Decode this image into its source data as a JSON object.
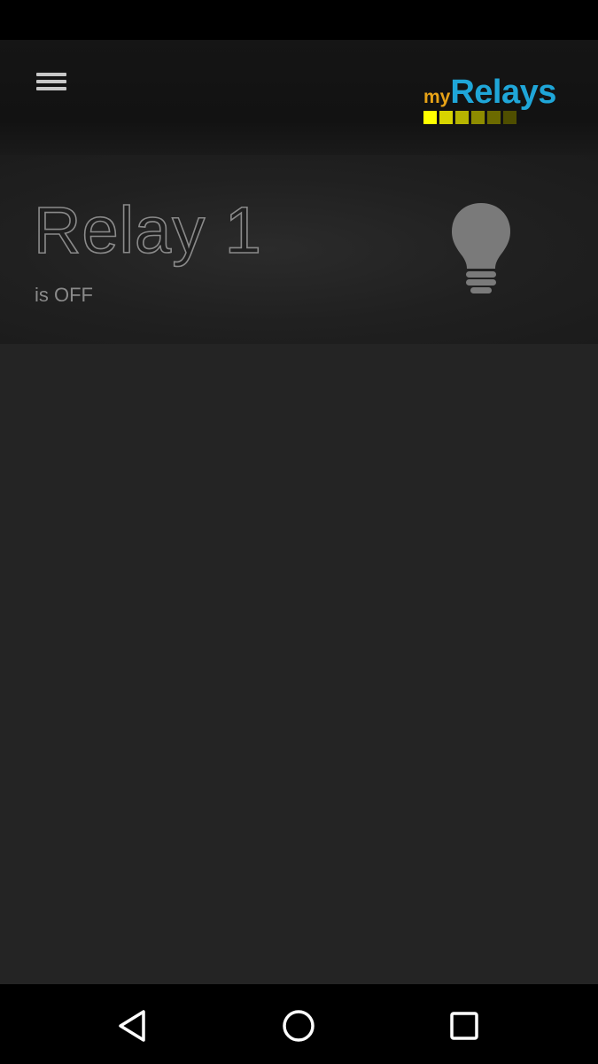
{
  "app": {
    "logo_prefix": "my",
    "logo_name": "Relays",
    "logo_colors": [
      "#ffff00",
      "#d7d400",
      "#b6b400",
      "#8e8c00",
      "#6c6a00",
      "#4f4e00"
    ]
  },
  "header": {
    "menu_icon": "menu-icon"
  },
  "relay": {
    "name": "Relay 1",
    "status": "is OFF",
    "state": "off",
    "icon": "lightbulb-icon",
    "icon_color": "#7a7a7a"
  },
  "navigation": {
    "back_icon": "back-icon",
    "home_icon": "home-icon",
    "recents_icon": "recents-icon"
  }
}
